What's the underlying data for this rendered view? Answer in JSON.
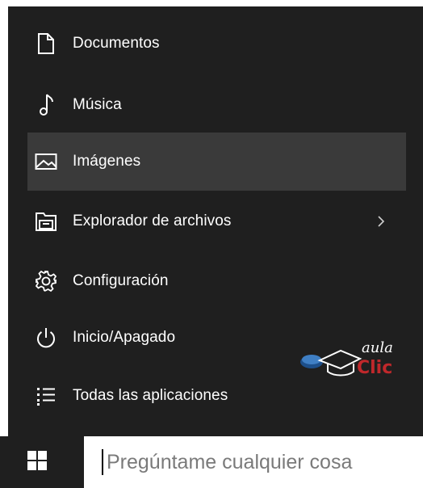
{
  "menu": {
    "items": [
      {
        "label": "Documentos",
        "icon": "document-icon"
      },
      {
        "label": "Música",
        "icon": "music-note-icon"
      },
      {
        "label": "Imágenes",
        "icon": "picture-icon",
        "highlighted": true
      },
      {
        "label": "Explorador de archivos",
        "icon": "file-explorer-icon",
        "has_submenu": true
      },
      {
        "label": "Configuración",
        "icon": "gear-icon"
      },
      {
        "label": "Inicio/Apagado",
        "icon": "power-icon"
      },
      {
        "label": "Todas las aplicaciones",
        "icon": "all-apps-list-icon"
      }
    ]
  },
  "watermark": {
    "top_text": "aula",
    "bottom_text": "Clic"
  },
  "taskbar": {
    "start_icon": "windows-logo-icon",
    "search": {
      "placeholder": "Pregúntame cualquier cosa"
    }
  },
  "colors": {
    "menu_background": "#1f1f1f",
    "highlight": "#3a3a3a",
    "text": "#ffffff",
    "search_background": "#ffffff",
    "placeholder": "#7a7a7a",
    "logo_red": "#c0282b",
    "logo_blue": "#1d4f8a"
  }
}
